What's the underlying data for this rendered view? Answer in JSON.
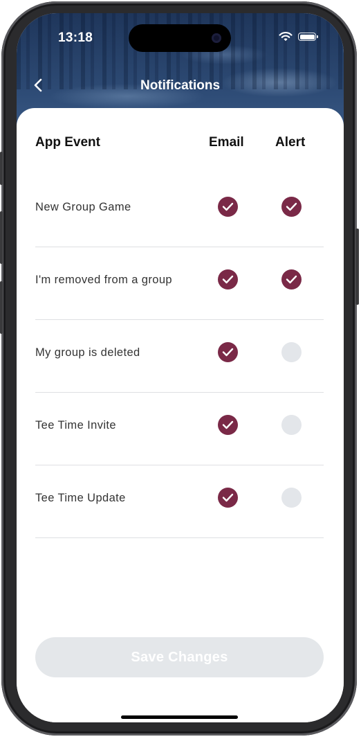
{
  "status_bar": {
    "time": "13:18"
  },
  "nav": {
    "title": "Notifications"
  },
  "table": {
    "headers": {
      "event": "App Event",
      "email": "Email",
      "alert": "Alert"
    },
    "rows": [
      {
        "label": "New Group Game",
        "email": true,
        "alert": true
      },
      {
        "label": "I'm removed from a group",
        "email": true,
        "alert": true
      },
      {
        "label": "My group is deleted",
        "email": true,
        "alert": false
      },
      {
        "label": "Tee Time Invite",
        "email": true,
        "alert": false
      },
      {
        "label": "Tee Time Update",
        "email": true,
        "alert": false
      }
    ]
  },
  "footer": {
    "save_label": "Save Changes"
  },
  "colors": {
    "accent": "#7a2947",
    "unchecked": "#e3e6ea",
    "button_disabled": "#e4e7ea"
  }
}
